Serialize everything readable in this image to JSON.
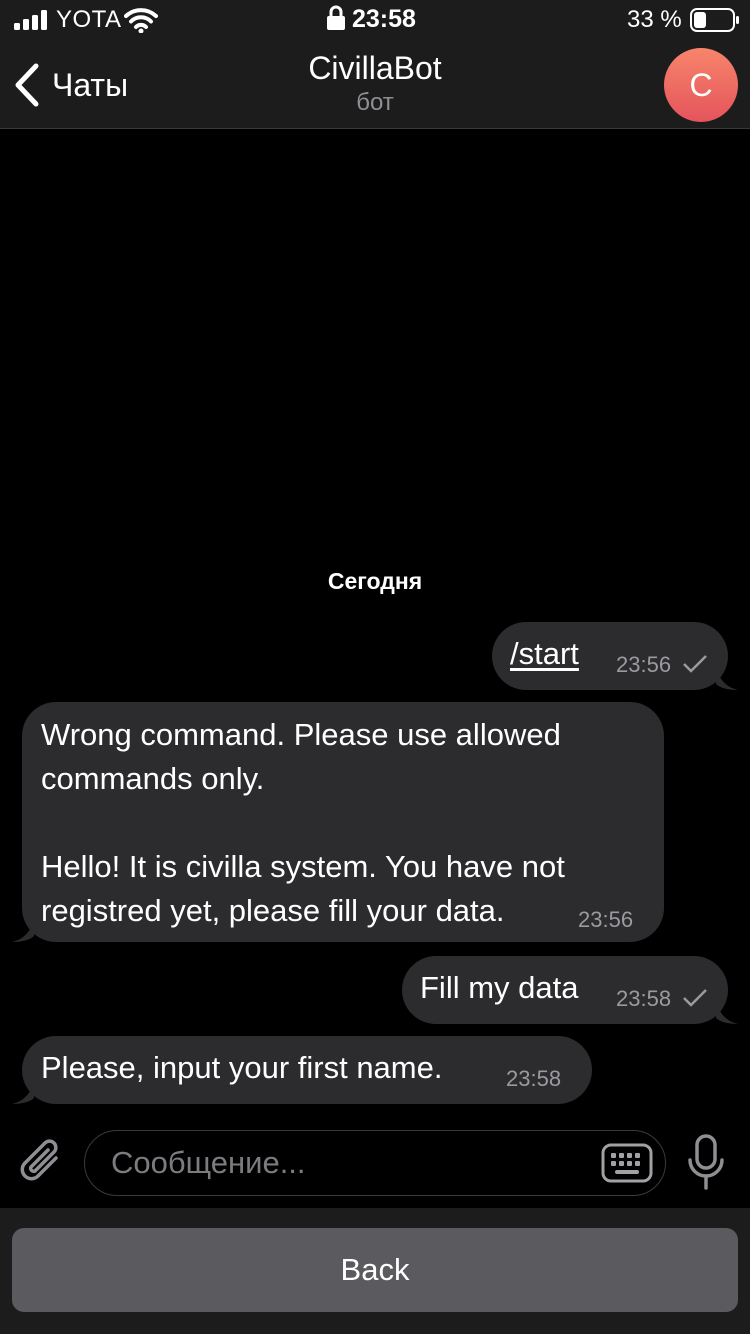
{
  "status": {
    "carrier": "YOTA",
    "time": "23:58",
    "battery": "33 %",
    "signal_icon": "signal-icon",
    "wifi_icon": "wifi-icon"
  },
  "header": {
    "back_label": "Чаты",
    "title": "CivillaBot",
    "subtitle": "бот",
    "avatar_letter": "C",
    "avatar_gradient": [
      "#f7856b",
      "#e5545c"
    ]
  },
  "chat": {
    "date_separator": "Сегодня",
    "messages": [
      {
        "direction": "outgoing",
        "text": "/start",
        "time": "23:56",
        "status": "sent"
      },
      {
        "direction": "incoming",
        "text": "Wrong command. Please use allowed\ncommands only.\n\nHello! It is civilla system. You have not\nregistred yet, please fill your data.",
        "time": "23:56"
      },
      {
        "direction": "outgoing",
        "text": "Fill my data",
        "time": "23:58",
        "status": "sent"
      },
      {
        "direction": "incoming",
        "text": "Please, input your first name.",
        "time": "23:58"
      }
    ]
  },
  "composer": {
    "placeholder": "Сообщение..."
  },
  "keyboard": {
    "buttons": [
      "Back"
    ]
  },
  "colors": {
    "background": "#000000",
    "bubble": "#2c2c2e",
    "bar": "#1c1c1d",
    "keyboard_button": "#5b5b5f"
  }
}
